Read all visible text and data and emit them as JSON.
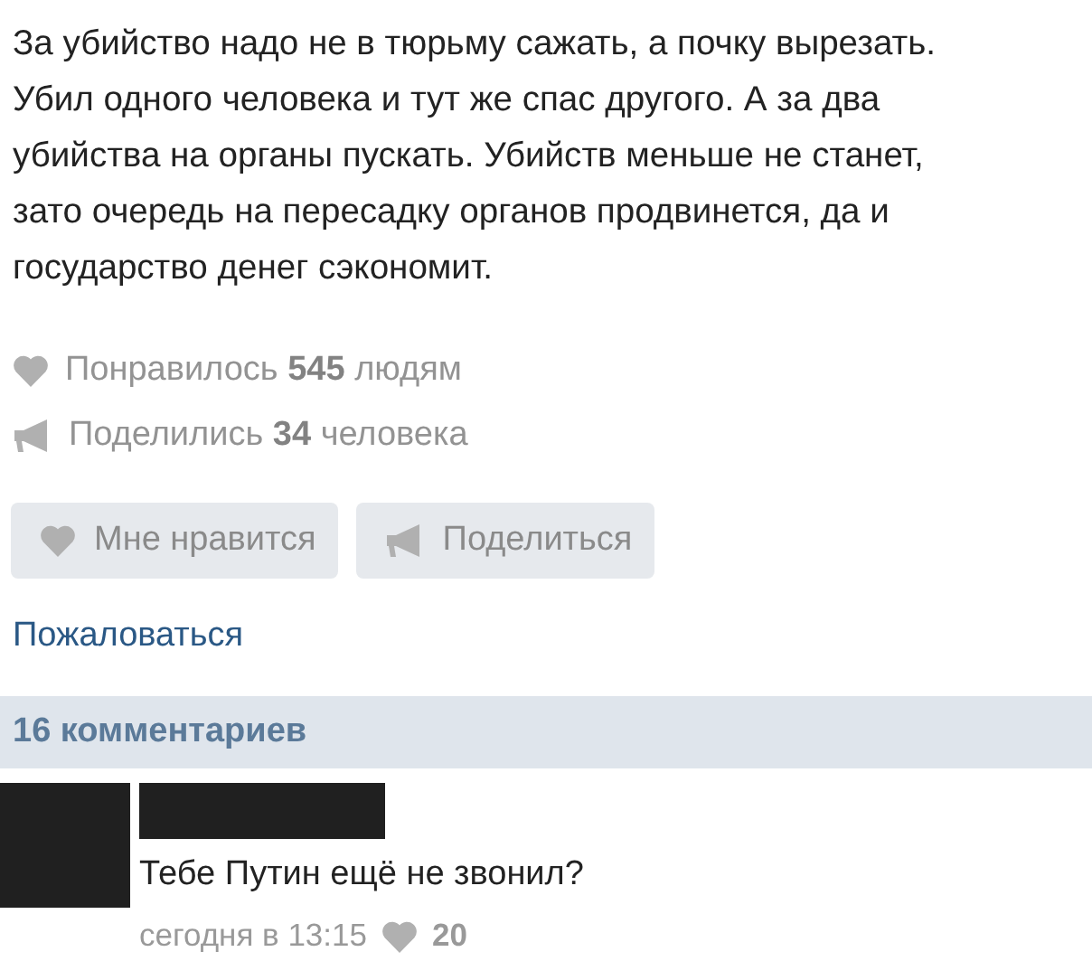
{
  "post": {
    "text": "За убийство надо не в тюрьму сажать, а почку вырезать.\nУбил одного человека и тут же спас другого. А за два\nубийства на органы пускать. Убийств меньше не станет,\nзато очередь на пересадку органов продвинется, да и\nгосударство денег сэкономит."
  },
  "stats": [
    {
      "kind": "likes",
      "text": "Понравилось **545** людям"
    },
    {
      "kind": "shares",
      "text": "Поделились **34** человека"
    }
  ],
  "actions": [
    {
      "kind": "like",
      "label": "Мне нравится"
    },
    {
      "kind": "share",
      "label": "Поделиться"
    }
  ],
  "report_link": "Пожаловаться",
  "comments_header": "16 комментариев",
  "comments": [
    {
      "text": "Тебе Путин ещё не звонил?",
      "time": "сегодня в 13:15",
      "likes": "20"
    }
  ]
}
